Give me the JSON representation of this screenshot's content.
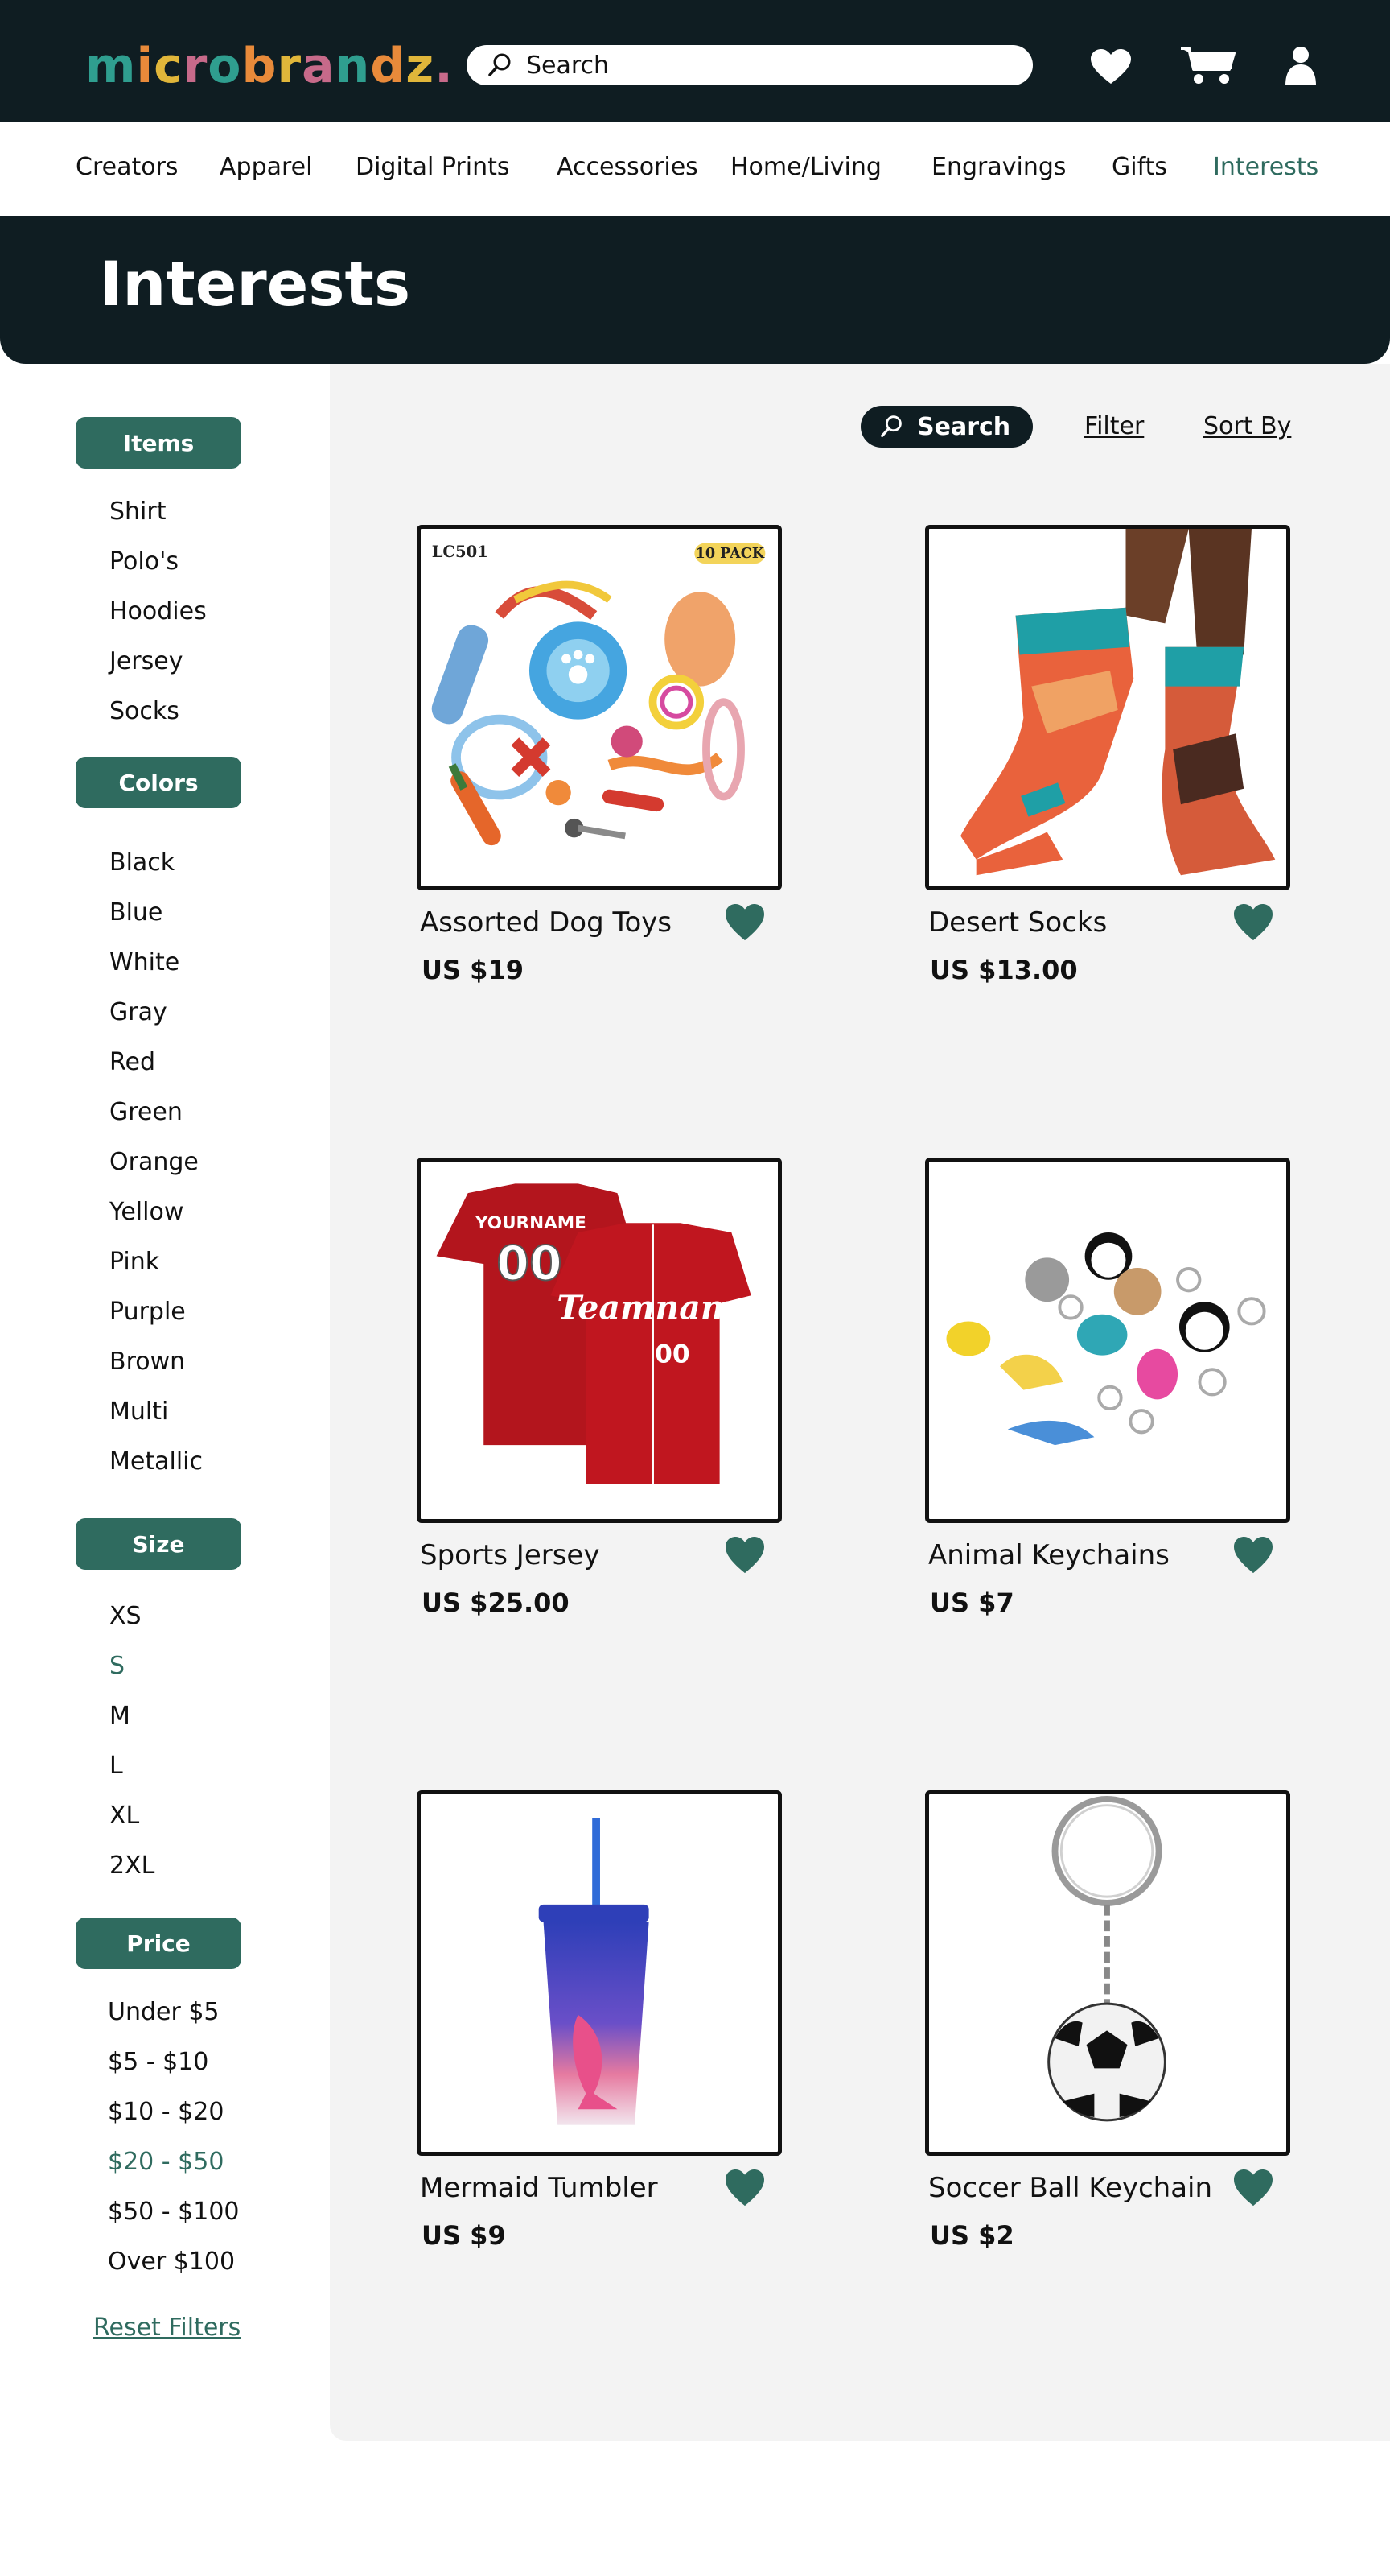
{
  "brand": {
    "logo_letters": [
      "m",
      "i",
      "c",
      "r",
      "o",
      "b",
      "r",
      "a",
      "n",
      "d",
      "z",
      "."
    ],
    "logo_colors": [
      "#2f9e8f",
      "#e88a3a",
      "#e0b63a",
      "#c76a8a",
      "#2f9e8f",
      "#e88a3a",
      "#e0b63a",
      "#c76a8a",
      "#2f9e8f",
      "#e88a3a",
      "#e0b63a",
      "#c76a8a"
    ]
  },
  "header": {
    "search_label": "Search",
    "icons": [
      "heart-icon",
      "cart-icon",
      "user-icon"
    ]
  },
  "nav": {
    "items": [
      "Creators",
      "Apparel",
      "Digital Prints",
      "Accessories",
      "Home/Living",
      "Engravings",
      "Gifts",
      "Interests"
    ],
    "active": "Interests"
  },
  "page": {
    "title": "Interests"
  },
  "sidebar": {
    "items_heading": "Items",
    "items": [
      "Shirt",
      "Polo's",
      "Hoodies",
      "Jersey",
      "Socks"
    ],
    "colors_heading": "Colors",
    "colors": [
      "Black",
      "Blue",
      "White",
      "Gray",
      "Red",
      "Green",
      "Orange",
      "Yellow",
      "Pink",
      "Purple",
      "Brown",
      "Multi",
      "Metallic"
    ],
    "size_heading": "Size",
    "sizes": [
      "XS",
      "S",
      "M",
      "L",
      "XL",
      "2XL"
    ],
    "selected_size": "S",
    "price_heading": "Price",
    "prices": [
      "Under $5",
      "$5 - $10",
      "$10 - $20",
      "$20 - $50",
      "$50 - $100",
      "Over $100"
    ],
    "selected_price": "$20 - $50",
    "reset_label": "Reset Filters"
  },
  "toolbar": {
    "search_label": "Search",
    "filter_label": "Filter",
    "sort_label": "Sort By"
  },
  "products": [
    {
      "name": "Assorted Dog Toys",
      "price": "US $19",
      "image": "dog-toys-image",
      "badge_left": "LC501",
      "badge_right": "10 PACK"
    },
    {
      "name": "Desert Socks",
      "price": "US $13.00",
      "image": "desert-socks-image"
    },
    {
      "name": "Sports Jersey",
      "price": "US $25.00",
      "image": "sports-jersey-image",
      "jersey_top": "YOURNAME",
      "jersey_num": "00",
      "jersey_script": "Teamname"
    },
    {
      "name": "Animal Keychains",
      "price": "US $7",
      "image": "animal-keychains-image"
    },
    {
      "name": "Mermaid Tumbler",
      "price": "US $9",
      "image": "mermaid-tumbler-image"
    },
    {
      "name": "Soccer Ball Keychain",
      "price": "US $2",
      "image": "soccer-keychain-image"
    }
  ],
  "colors": {
    "dark": "#0f1d22",
    "accent": "#2f6b5f",
    "panel": "#f3f3f3"
  }
}
